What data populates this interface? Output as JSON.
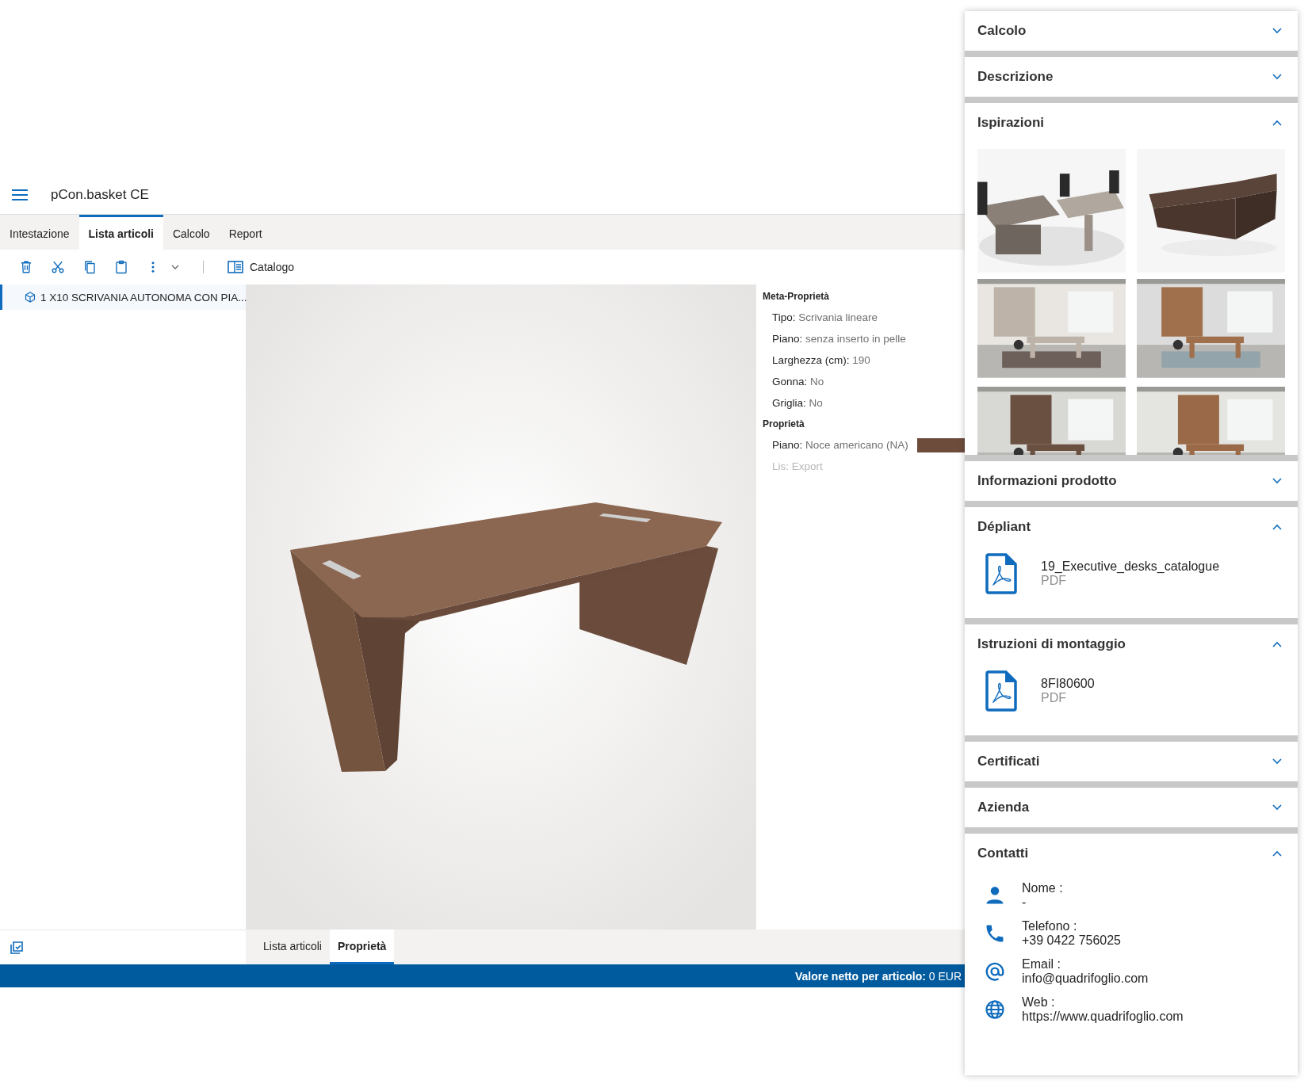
{
  "app": {
    "title": "pCon.basket CE"
  },
  "tabs": [
    {
      "label": "Intestazione",
      "selected": false
    },
    {
      "label": "Lista articoli",
      "selected": true
    },
    {
      "label": "Calcolo",
      "selected": false
    },
    {
      "label": "Report",
      "selected": false
    }
  ],
  "toolbar": {
    "catalog_label": "Catalogo"
  },
  "article_list": [
    {
      "text": "1 X10 SCRIVANIA AUTONOMA CON PIA...",
      "selected": true
    }
  ],
  "properties": {
    "groups": [
      {
        "title": "Meta-Proprietà",
        "items": [
          {
            "key": "Tipo:",
            "value": "Scrivania lineare",
            "disabled": false
          },
          {
            "key": "Piano:",
            "value": "senza inserto in pelle",
            "disabled": false
          },
          {
            "key": "Larghezza (cm):",
            "value": "190",
            "disabled": false
          },
          {
            "key": "Gonna:",
            "value": "No",
            "disabled": false
          },
          {
            "key": "Griglia:",
            "value": "No",
            "disabled": false
          }
        ]
      },
      {
        "title": "Proprietà",
        "items": [
          {
            "key": "Piano:",
            "value": "Noce americano (NA)",
            "disabled": false,
            "color": "#6e4c3c"
          },
          {
            "key": "Lis:",
            "value": "Export",
            "disabled": true
          }
        ]
      }
    ]
  },
  "bottom_tabs": [
    {
      "label": "Lista articoli",
      "selected": false
    },
    {
      "label": "Proprietà",
      "selected": true
    }
  ],
  "status_bar": {
    "text": "**Valore netto per articolo:** 0 EUR"
  },
  "panel": {
    "sections": [
      {
        "kind": "plain",
        "title": "Calcolo",
        "expanded": false
      },
      {
        "kind": "plain",
        "title": "Descrizione",
        "expanded": false
      },
      {
        "kind": "gallery",
        "title": "Ispirazioni",
        "expanded": true
      },
      {
        "kind": "plain",
        "title": "Informazioni prodotto",
        "expanded": false
      },
      {
        "kind": "files",
        "title": "Dépliant",
        "expanded": true,
        "files": [
          {
            "name": "19_Executive_desks_catalogue",
            "type": "PDF"
          }
        ]
      },
      {
        "kind": "files",
        "title": "Istruzioni di montaggio",
        "expanded": true,
        "files": [
          {
            "name": "8FI80600",
            "type": "PDF"
          }
        ]
      },
      {
        "kind": "plain",
        "title": "Certificati",
        "expanded": false
      },
      {
        "kind": "plain",
        "title": "Azienda",
        "expanded": false
      },
      {
        "kind": "contacts",
        "title": "Contatti",
        "expanded": true,
        "contacts": [
          {
            "kind": "person",
            "label": "Nome :",
            "value": "-"
          },
          {
            "kind": "phone",
            "label": "Telefono :",
            "value": "+39 0422 756025"
          },
          {
            "kind": "email",
            "label": "Email :",
            "value": "info@quadrifoglio.com"
          },
          {
            "kind": "web",
            "label": "Web :",
            "value": "https://www.quadrifoglio.com"
          }
        ]
      }
    ]
  }
}
